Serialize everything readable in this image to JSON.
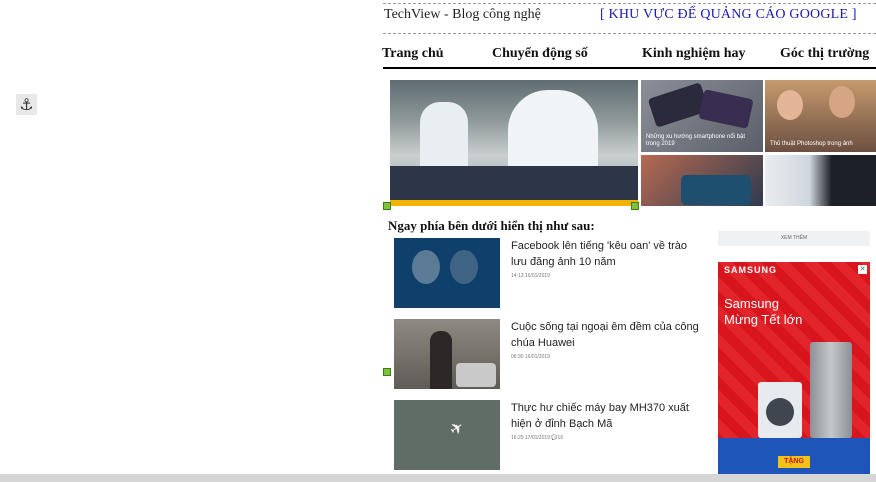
{
  "header": {
    "site_name": "TechView - Blog công nghệ",
    "ad_slot_text": "[ KHU VỰC ĐỂ QUẢNG CÁO GOOGLE ]"
  },
  "nav": {
    "items": [
      {
        "label": "Trang chủ"
      },
      {
        "label": "Chuyển động số"
      },
      {
        "label": "Kinh nghiệm hay"
      },
      {
        "label": "Góc thị trường"
      }
    ]
  },
  "featured": {
    "hero_caption": "",
    "tiles": [
      {
        "caption": "Những xu hướng smartphone nổi bật trong 2019"
      },
      {
        "caption": "Thủ thuật Photoshop trong ảnh"
      },
      {
        "caption": ""
      },
      {
        "caption": ""
      }
    ]
  },
  "section": {
    "title": "Ngay phía bên dưới hiển thị như sau:"
  },
  "news": [
    {
      "title": "Facebook lên tiếng 'kêu oan' về trào lưu đăng ảnh 10 năm",
      "meta": "14:13 16/01/2019"
    },
    {
      "title": "Cuộc sống tại ngoại êm đềm của công chúa Huawei",
      "meta": "06:30 16/01/2019"
    },
    {
      "title": "Thực hư chiếc máy bay MH370 xuất hiện ở đỉnh Bạch Mã",
      "meta": "16:29 17/01/2019 💬16"
    }
  ],
  "sidebar": {
    "see_more": "XEM THÊM",
    "ad": {
      "brand": "SAMSUNG",
      "headline_line1": "Samsung",
      "headline_line2": "Mừng Tết lớn",
      "cta": "TẶNG"
    }
  },
  "icons": {
    "anchor": "anchor-icon",
    "close": "close-icon",
    "plane": "plane-icon"
  }
}
